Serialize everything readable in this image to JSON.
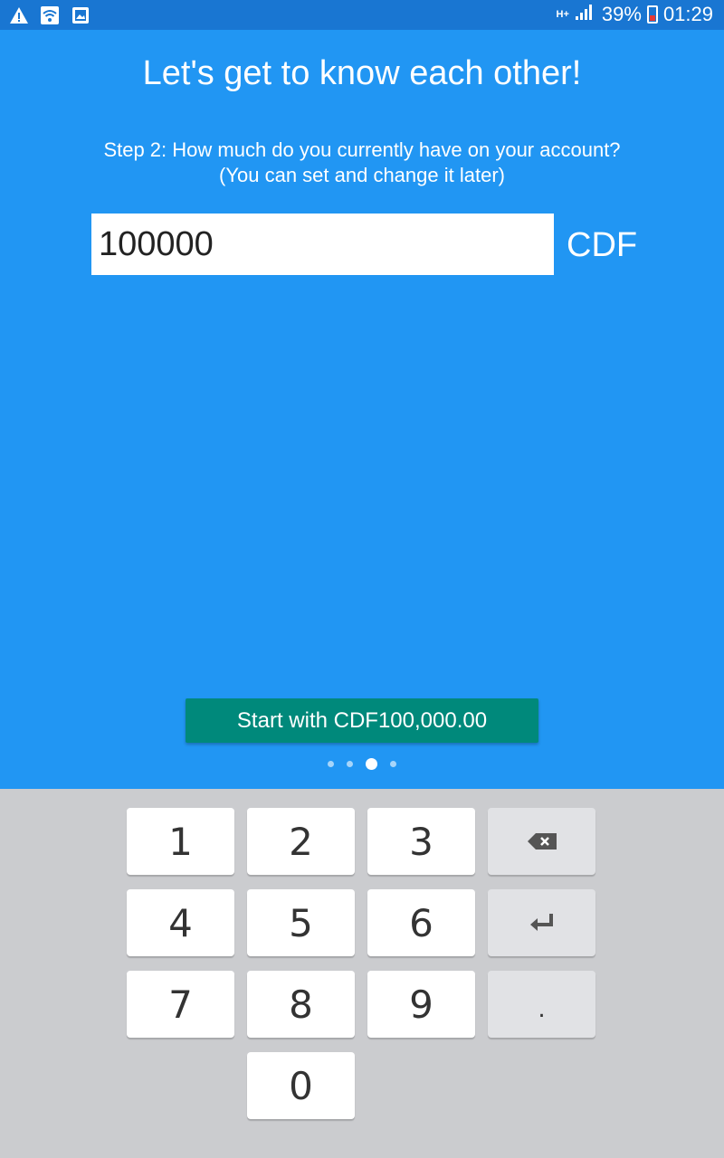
{
  "status_bar": {
    "network": "H+",
    "battery": "39%",
    "time": "01:29"
  },
  "title": "Let's get to know each other!",
  "step": {
    "line1": "Step 2: How much do you currently have on your account?",
    "line2": "(You can set and change it later)"
  },
  "amount_input": {
    "value": "100000"
  },
  "currency": "CDF",
  "start_button_label": "Start with CDF100,000.00",
  "pager": {
    "total": 4,
    "active": 3
  },
  "keypad": {
    "k1": "1",
    "k2": "2",
    "k3": "3",
    "k4": "4",
    "k5": "5",
    "k6": "6",
    "k7": "7",
    "k8": "8",
    "k9": "9",
    "k0": "0",
    "dot": ".",
    "backspace_icon": "backspace-icon",
    "enter_icon": "enter-icon"
  }
}
